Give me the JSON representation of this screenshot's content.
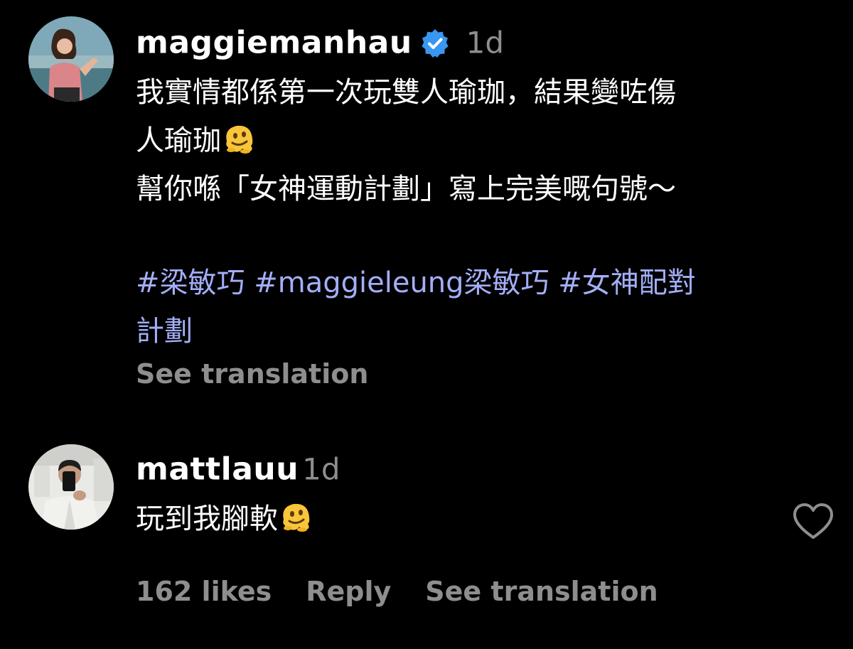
{
  "post_comment": {
    "username": "maggiemanhau",
    "verified": true,
    "time": "1d",
    "text_lines": [
      "我實情都係第一次玩雙人瑜珈，結果變咗傷",
      "人瑜珈",
      "幫你喺「女神運動計劃」寫上完美嘅句號～"
    ],
    "emoji": "melting-face-icon",
    "hashtags": [
      "#梁敏巧",
      "#maggieleung梁敏巧",
      "#女神配對",
      "計劃"
    ],
    "see_translation": "See translation"
  },
  "reply_comment": {
    "username": "mattlauu",
    "time": "1d",
    "text": "玩到我腳軟",
    "emoji": "melting-face-icon",
    "likes": "162 likes",
    "reply_label": "Reply",
    "see_translation": "See translation",
    "like_icon": "heart-outline-icon"
  },
  "colors": {
    "background": "#000000",
    "text": "#ffffff",
    "muted": "#8e8e8e",
    "hashtag": "#a3aef8",
    "verified": "#3897f0"
  }
}
